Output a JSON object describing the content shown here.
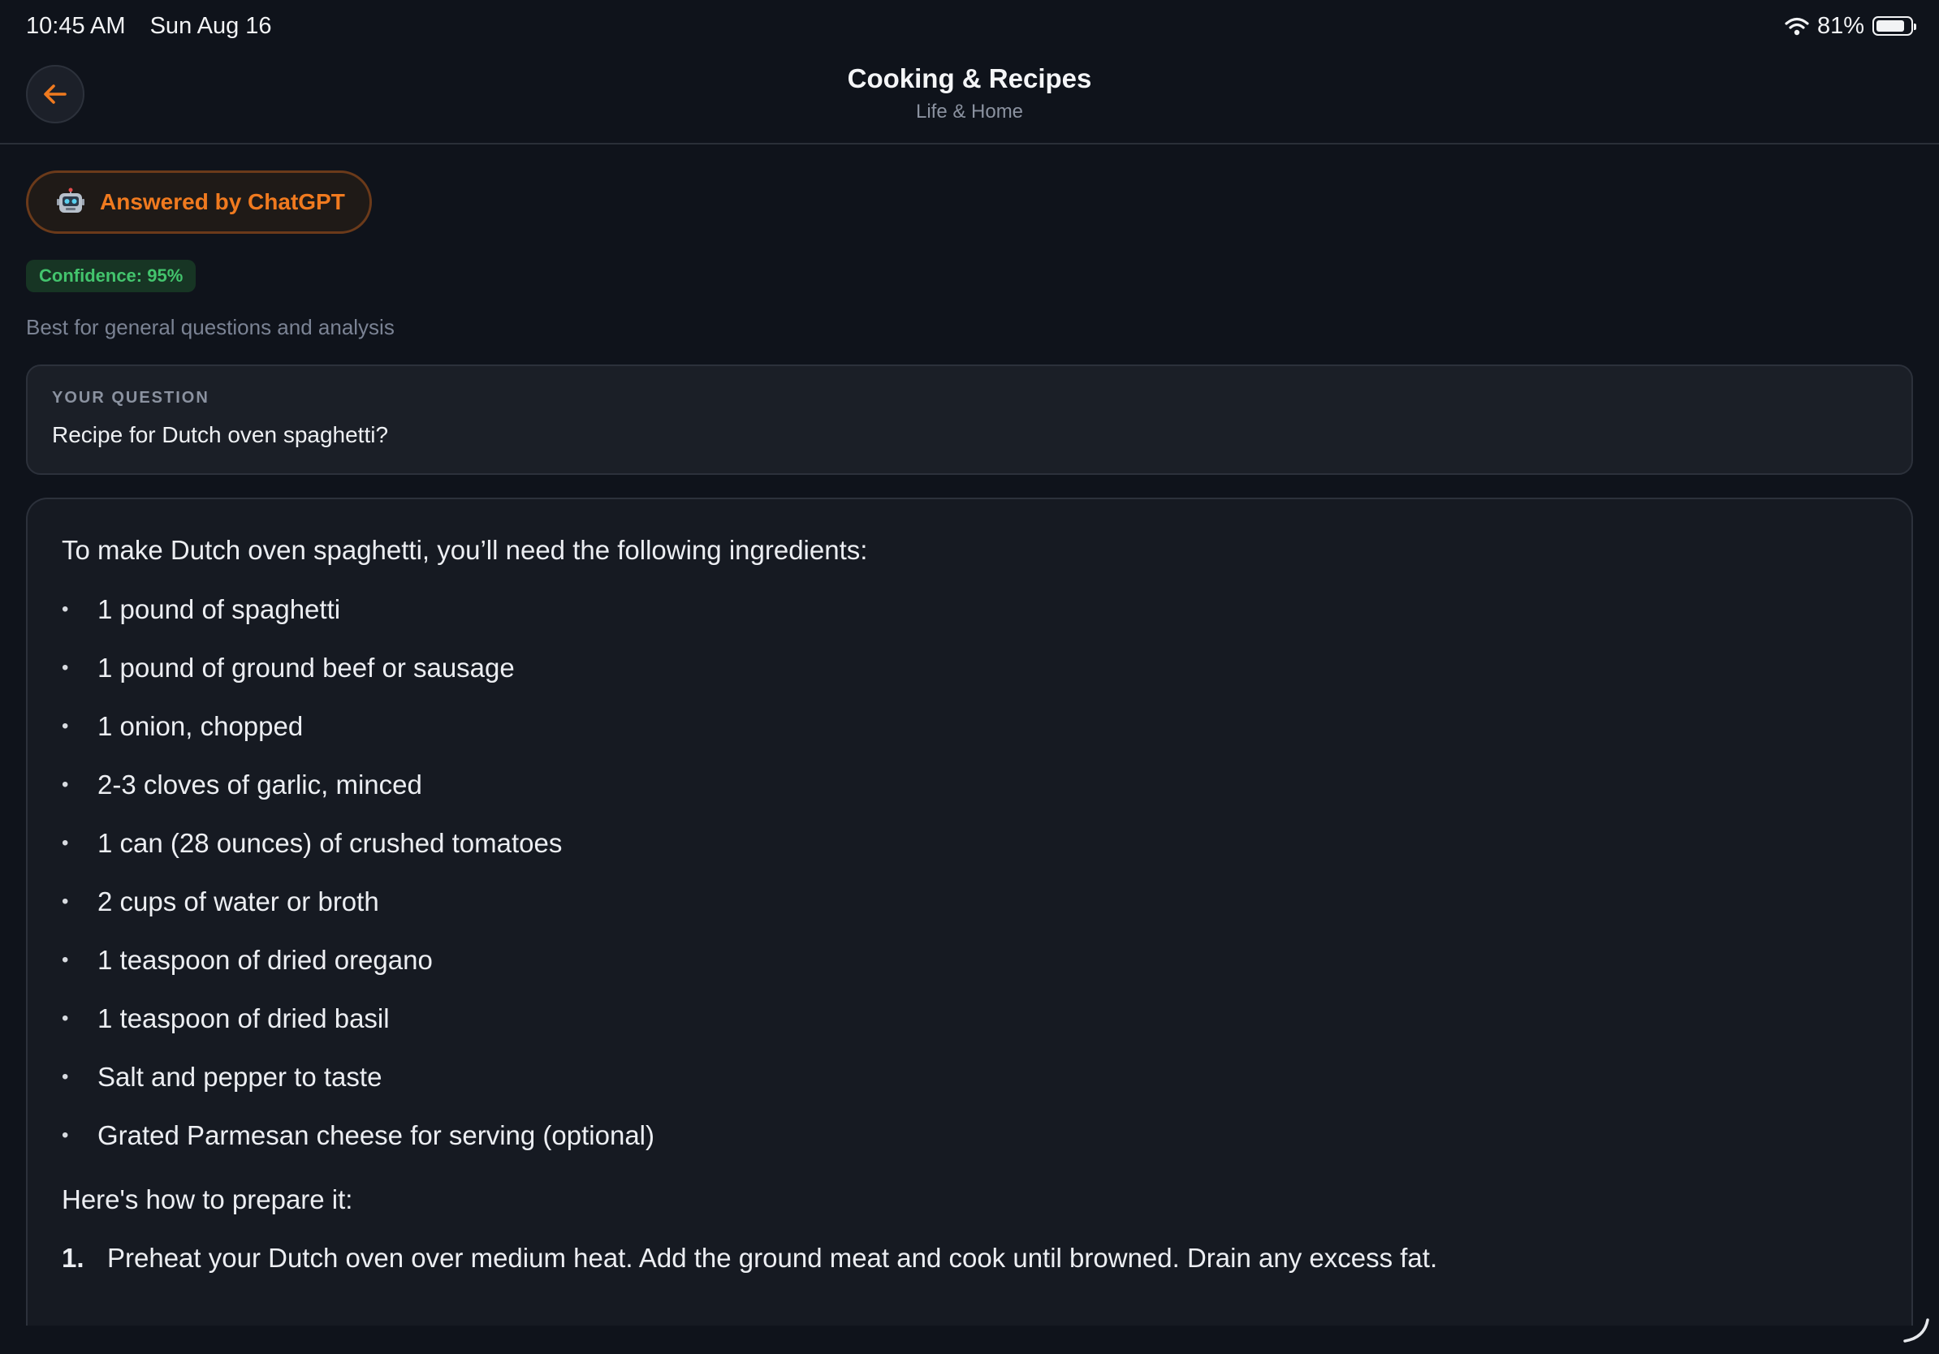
{
  "status_bar": {
    "time": "10:45 AM",
    "date": "Sun Aug 16",
    "battery": "81%"
  },
  "header": {
    "title": "Cooking & Recipes",
    "subtitle": "Life & Home"
  },
  "answer_meta": {
    "answered_by": "Answered by ChatGPT",
    "confidence": "Confidence: 95%",
    "best_for": "Best for general questions and analysis"
  },
  "question": {
    "label": "YOUR QUESTION",
    "text": "Recipe for Dutch oven spaghetti?"
  },
  "answer": {
    "intro": "To make Dutch oven spaghetti, you’ll need the following ingredients:",
    "ingredients": [
      "1 pound of spaghetti",
      "1 pound of ground beef or sausage",
      "1 onion, chopped",
      "2-3 cloves of garlic, minced",
      "1 can (28 ounces) of crushed tomatoes",
      "2 cups of water or broth",
      "1 teaspoon of dried oregano",
      "1 teaspoon of dried basil",
      "Salt and pepper to taste",
      "Grated Parmesan cheese for serving (optional)"
    ],
    "prep_intro": "Here's how to prepare it:",
    "steps": [
      {
        "num": "1.",
        "text": "Preheat your Dutch oven over medium heat. Add the ground meat and cook until browned. Drain any excess fat."
      }
    ]
  },
  "colors": {
    "accent": "#f07a1f",
    "confidence_green": "#43c46d",
    "background": "#0f131b"
  },
  "icons": {
    "back": "arrow-left-icon",
    "bot": "robot-icon",
    "wifi": "wifi-icon",
    "battery": "battery-icon"
  }
}
